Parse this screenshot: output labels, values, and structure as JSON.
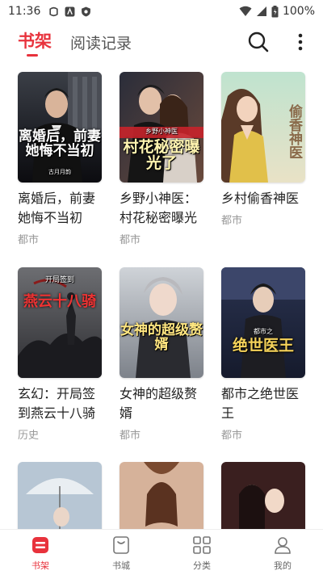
{
  "status_bar": {
    "time": "11:36",
    "battery": "100%"
  },
  "header": {
    "tabs": [
      {
        "label": "书架",
        "active": true
      },
      {
        "label": "阅读记录",
        "active": false
      }
    ],
    "accent_color": "#e8323c"
  },
  "books": [
    {
      "title": "离婚后，前妻她悔不当初",
      "category": "都市",
      "cover_text": "离婚后，前妻她悔不当初",
      "cover_author": "古月月韵"
    },
    {
      "title": "乡野小神医：村花秘密曝光",
      "category": "都市",
      "cover_text": "村花秘密曝光了",
      "cover_sub": "乡野小神医"
    },
    {
      "title": "乡村偷香神医",
      "category": "都市",
      "cover_text": "偷香神医"
    },
    {
      "title": "玄幻：开局签到燕云十八骑",
      "category": "历史",
      "cover_text": "燕云十八骑",
      "cover_sub": "开局签到"
    },
    {
      "title": "女神的超级赘婿",
      "category": "都市",
      "cover_text": "女神的超级赘婿"
    },
    {
      "title": "都市之绝世医王",
      "category": "都市",
      "cover_text": "绝世医王",
      "cover_sub": "都市之"
    },
    {
      "title": "",
      "category": ""
    },
    {
      "title": "",
      "category": ""
    },
    {
      "title": "",
      "category": ""
    }
  ],
  "bottom_nav": [
    {
      "label": "书架",
      "icon": "bookshelf-icon",
      "active": true
    },
    {
      "label": "书城",
      "icon": "bookstore-icon",
      "active": false
    },
    {
      "label": "分类",
      "icon": "category-grid-icon",
      "active": false
    },
    {
      "label": "我的",
      "icon": "profile-icon",
      "active": false
    }
  ]
}
